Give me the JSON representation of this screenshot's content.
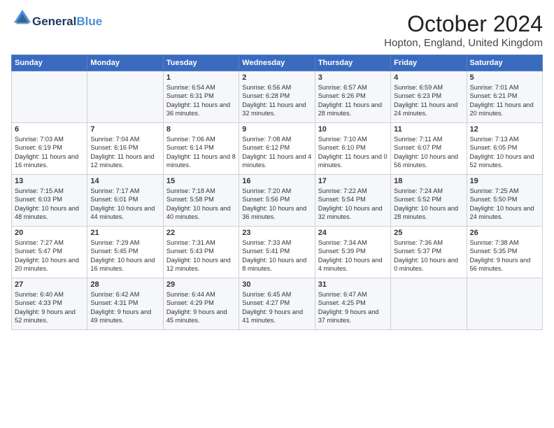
{
  "header": {
    "logo_line1": "General",
    "logo_line2": "Blue",
    "month_title": "October 2024",
    "location": "Hopton, England, United Kingdom"
  },
  "weekdays": [
    "Sunday",
    "Monday",
    "Tuesday",
    "Wednesday",
    "Thursday",
    "Friday",
    "Saturday"
  ],
  "weeks": [
    [
      {
        "day": "",
        "content": ""
      },
      {
        "day": "",
        "content": ""
      },
      {
        "day": "1",
        "content": "Sunrise: 6:54 AM\nSunset: 6:31 PM\nDaylight: 11 hours and 36 minutes."
      },
      {
        "day": "2",
        "content": "Sunrise: 6:56 AM\nSunset: 6:28 PM\nDaylight: 11 hours and 32 minutes."
      },
      {
        "day": "3",
        "content": "Sunrise: 6:57 AM\nSunset: 6:26 PM\nDaylight: 11 hours and 28 minutes."
      },
      {
        "day": "4",
        "content": "Sunrise: 6:59 AM\nSunset: 6:23 PM\nDaylight: 11 hours and 24 minutes."
      },
      {
        "day": "5",
        "content": "Sunrise: 7:01 AM\nSunset: 6:21 PM\nDaylight: 11 hours and 20 minutes."
      }
    ],
    [
      {
        "day": "6",
        "content": "Sunrise: 7:03 AM\nSunset: 6:19 PM\nDaylight: 11 hours and 16 minutes."
      },
      {
        "day": "7",
        "content": "Sunrise: 7:04 AM\nSunset: 6:16 PM\nDaylight: 11 hours and 12 minutes."
      },
      {
        "day": "8",
        "content": "Sunrise: 7:06 AM\nSunset: 6:14 PM\nDaylight: 11 hours and 8 minutes."
      },
      {
        "day": "9",
        "content": "Sunrise: 7:08 AM\nSunset: 6:12 PM\nDaylight: 11 hours and 4 minutes."
      },
      {
        "day": "10",
        "content": "Sunrise: 7:10 AM\nSunset: 6:10 PM\nDaylight: 11 hours and 0 minutes."
      },
      {
        "day": "11",
        "content": "Sunrise: 7:11 AM\nSunset: 6:07 PM\nDaylight: 10 hours and 56 minutes."
      },
      {
        "day": "12",
        "content": "Sunrise: 7:13 AM\nSunset: 6:05 PM\nDaylight: 10 hours and 52 minutes."
      }
    ],
    [
      {
        "day": "13",
        "content": "Sunrise: 7:15 AM\nSunset: 6:03 PM\nDaylight: 10 hours and 48 minutes."
      },
      {
        "day": "14",
        "content": "Sunrise: 7:17 AM\nSunset: 6:01 PM\nDaylight: 10 hours and 44 minutes."
      },
      {
        "day": "15",
        "content": "Sunrise: 7:18 AM\nSunset: 5:58 PM\nDaylight: 10 hours and 40 minutes."
      },
      {
        "day": "16",
        "content": "Sunrise: 7:20 AM\nSunset: 5:56 PM\nDaylight: 10 hours and 36 minutes."
      },
      {
        "day": "17",
        "content": "Sunrise: 7:22 AM\nSunset: 5:54 PM\nDaylight: 10 hours and 32 minutes."
      },
      {
        "day": "18",
        "content": "Sunrise: 7:24 AM\nSunset: 5:52 PM\nDaylight: 10 hours and 28 minutes."
      },
      {
        "day": "19",
        "content": "Sunrise: 7:25 AM\nSunset: 5:50 PM\nDaylight: 10 hours and 24 minutes."
      }
    ],
    [
      {
        "day": "20",
        "content": "Sunrise: 7:27 AM\nSunset: 5:47 PM\nDaylight: 10 hours and 20 minutes."
      },
      {
        "day": "21",
        "content": "Sunrise: 7:29 AM\nSunset: 5:45 PM\nDaylight: 10 hours and 16 minutes."
      },
      {
        "day": "22",
        "content": "Sunrise: 7:31 AM\nSunset: 5:43 PM\nDaylight: 10 hours and 12 minutes."
      },
      {
        "day": "23",
        "content": "Sunrise: 7:33 AM\nSunset: 5:41 PM\nDaylight: 10 hours and 8 minutes."
      },
      {
        "day": "24",
        "content": "Sunrise: 7:34 AM\nSunset: 5:39 PM\nDaylight: 10 hours and 4 minutes."
      },
      {
        "day": "25",
        "content": "Sunrise: 7:36 AM\nSunset: 5:37 PM\nDaylight: 10 hours and 0 minutes."
      },
      {
        "day": "26",
        "content": "Sunrise: 7:38 AM\nSunset: 5:35 PM\nDaylight: 9 hours and 56 minutes."
      }
    ],
    [
      {
        "day": "27",
        "content": "Sunrise: 6:40 AM\nSunset: 4:33 PM\nDaylight: 9 hours and 52 minutes."
      },
      {
        "day": "28",
        "content": "Sunrise: 6:42 AM\nSunset: 4:31 PM\nDaylight: 9 hours and 49 minutes."
      },
      {
        "day": "29",
        "content": "Sunrise: 6:44 AM\nSunset: 4:29 PM\nDaylight: 9 hours and 45 minutes."
      },
      {
        "day": "30",
        "content": "Sunrise: 6:45 AM\nSunset: 4:27 PM\nDaylight: 9 hours and 41 minutes."
      },
      {
        "day": "31",
        "content": "Sunrise: 6:47 AM\nSunset: 4:25 PM\nDaylight: 9 hours and 37 minutes."
      },
      {
        "day": "",
        "content": ""
      },
      {
        "day": "",
        "content": ""
      }
    ]
  ]
}
